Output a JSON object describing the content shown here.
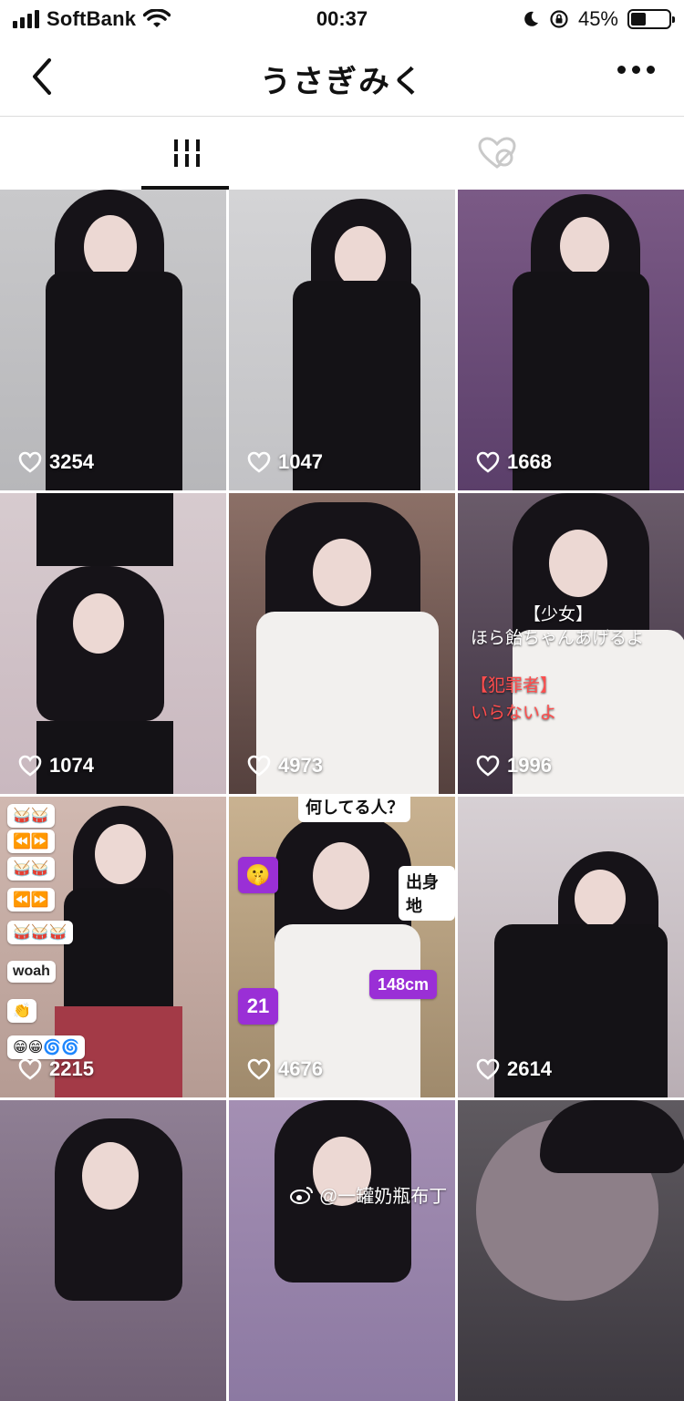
{
  "status_bar": {
    "carrier": "SoftBank",
    "time": "00:37",
    "battery_percent": "45%",
    "battery_level": 0.45,
    "icons": [
      "signal-icon",
      "wifi-icon",
      "moon-icon",
      "rotation-lock-icon",
      "battery-icon"
    ]
  },
  "nav": {
    "title": "うさぎみく",
    "icons": [
      "back-icon",
      "more-icon"
    ]
  },
  "tabs": [
    {
      "name": "videos",
      "icon": "grid-icon",
      "selected": true
    },
    {
      "name": "liked",
      "icon": "hidden-heart-icon",
      "selected": false
    }
  ],
  "videos": [
    {
      "likes": "3254"
    },
    {
      "likes": "1047"
    },
    {
      "likes": "1668"
    },
    {
      "likes": "1074"
    },
    {
      "likes": "4973"
    },
    {
      "likes": "1996",
      "overlay": {
        "line1": "【少女】",
        "line2": "ほら飴ちゃんあげるよ",
        "line3": "【犯罪者】",
        "line4": "いらないよ"
      }
    },
    {
      "likes": "2215",
      "stickers": [
        "woah"
      ]
    },
    {
      "likes": "4676",
      "overlay": {
        "top": "何してる人？",
        "bubble": "出身地",
        "tag": "148cm",
        "number": "21"
      }
    },
    {
      "likes": "2614"
    },
    {
      "likes": ""
    },
    {
      "likes": ""
    },
    {
      "likes": ""
    }
  ],
  "watermark": {
    "text": "@一罐奶瓶布丁",
    "icon": "weibo-icon"
  },
  "colors": {
    "accent": "#111111",
    "badge_purple": "#9a2fd6",
    "overlay_red": "#ff4d4d"
  }
}
